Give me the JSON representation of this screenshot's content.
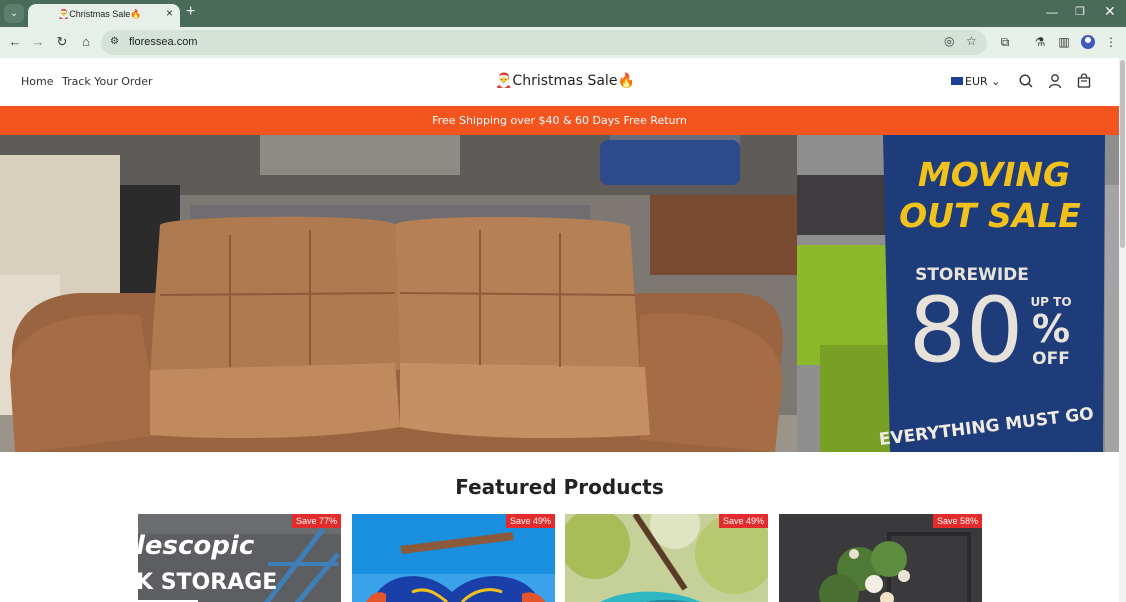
{
  "browser": {
    "tab_title": "🎅Christmas Sale🔥",
    "url": "floressea.com"
  },
  "header": {
    "nav": [
      "Home",
      "Track Your Order"
    ],
    "logo": "🎅Christmas Sale🔥",
    "currency": "EUR"
  },
  "promo_bar": "Free Shipping over $40 & 60 Days Free Return",
  "hero": {
    "headline": "MOVING OUT SALE",
    "storewide": "STOREWIDE",
    "percent": "80",
    "up_to": "UP TO",
    "pct_sign": "%",
    "off": "OFF",
    "footer": "EVERYTHING MUST GO"
  },
  "featured": {
    "title": "Featured Products",
    "products": [
      {
        "badge": "Save 77%",
        "overlay": [
          "lescopic",
          "K STORAGE"
        ]
      },
      {
        "badge": "Save 49%"
      },
      {
        "badge": "Save 49%"
      },
      {
        "badge": "Save 58%"
      }
    ]
  }
}
